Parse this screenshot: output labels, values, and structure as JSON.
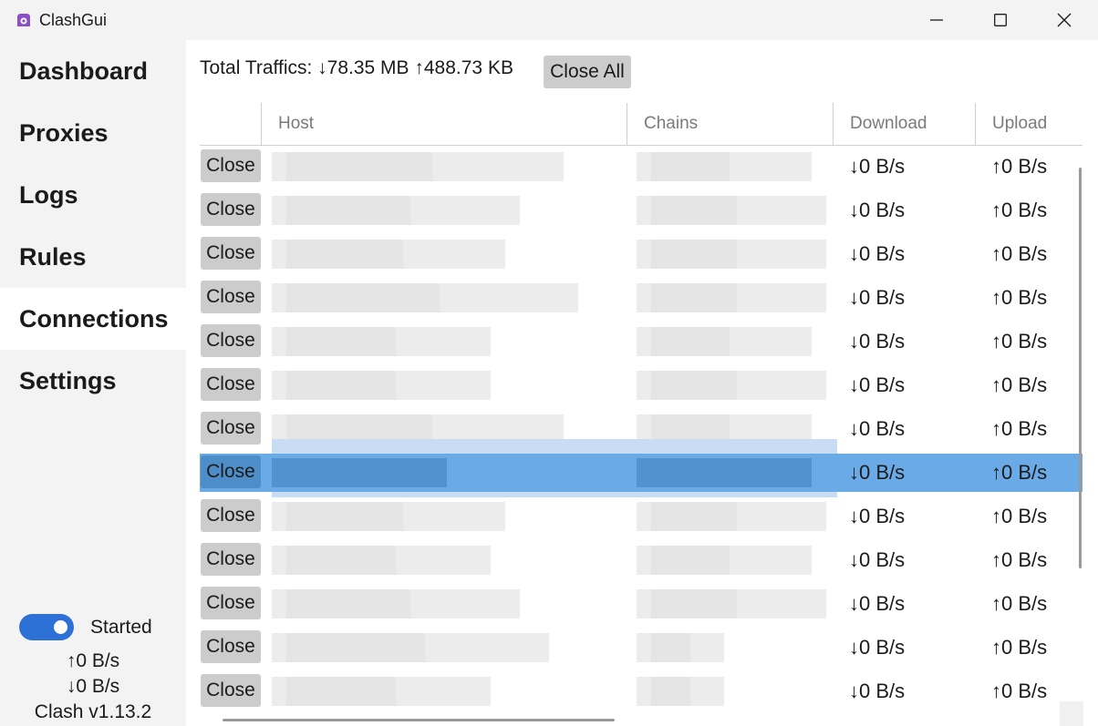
{
  "window": {
    "title": "ClashGui",
    "icon": "clash-icon",
    "controls": [
      "minimize-icon",
      "maximize-icon",
      "close-icon"
    ]
  },
  "sidebar": {
    "items": [
      {
        "label": "Dashboard",
        "active": false
      },
      {
        "label": "Proxies",
        "active": false
      },
      {
        "label": "Logs",
        "active": false
      },
      {
        "label": "Rules",
        "active": false
      },
      {
        "label": "Connections",
        "active": true
      },
      {
        "label": "Settings",
        "active": false
      }
    ],
    "toggle_on": true,
    "toggle_label": "Started",
    "upload_speed": "↑0 B/s",
    "download_speed": "↓0 B/s",
    "version": "Clash v1.13.2"
  },
  "main": {
    "total_traffic": "Total Traffics: ↓78.35 MB ↑488.73 KB",
    "close_all_label": "Close All",
    "columns": [
      "",
      "Host",
      "Chains",
      "Download",
      "Upload"
    ],
    "rows": [
      {
        "close": "Close",
        "download": "↓0 B/s",
        "upload": "↑0 B/s"
      },
      {
        "close": "Close",
        "download": "↓0 B/s",
        "upload": "↑0 B/s"
      },
      {
        "close": "Close",
        "download": "↓0 B/s",
        "upload": "↑0 B/s"
      },
      {
        "close": "Close",
        "download": "↓0 B/s",
        "upload": "↑0 B/s"
      },
      {
        "close": "Close",
        "download": "↓0 B/s",
        "upload": "↑0 B/s"
      },
      {
        "close": "Close",
        "download": "↓0 B/s",
        "upload": "↑0 B/s"
      },
      {
        "close": "Close",
        "download": "↓0 B/s",
        "upload": "↑0 B/s"
      },
      {
        "close": "Close",
        "download": "↓0 B/s",
        "upload": "↑0 B/s",
        "selected": true
      },
      {
        "close": "Close",
        "download": "↓0 B/s",
        "upload": "↑0 B/s"
      },
      {
        "close": "Close",
        "download": "↓0 B/s",
        "upload": "↑0 B/s"
      },
      {
        "close": "Close",
        "download": "↓0 B/s",
        "upload": "↑0 B/s"
      },
      {
        "close": "Close",
        "download": "↓0 B/s",
        "upload": "↑0 B/s"
      },
      {
        "close": "Close",
        "download": "↓0 B/s",
        "upload": "↑0 B/s"
      }
    ],
    "colors": {
      "selection": "#6aaae6",
      "toggle": "#2e71d6"
    }
  }
}
